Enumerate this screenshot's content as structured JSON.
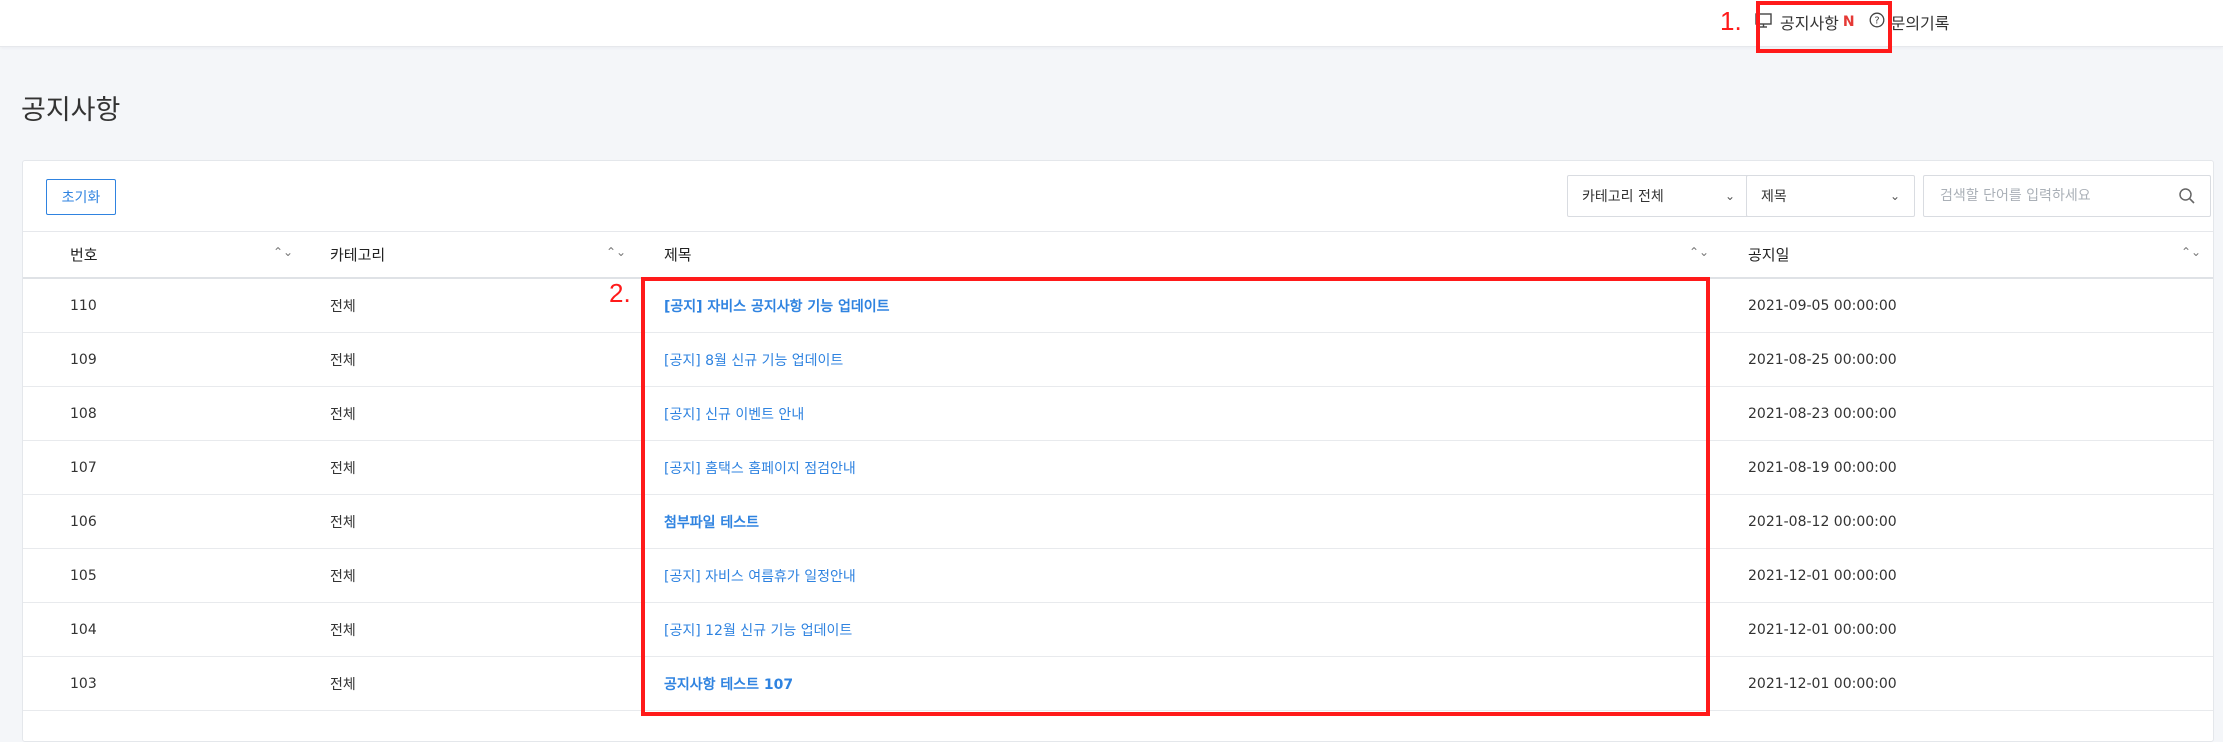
{
  "header": {
    "nav": [
      {
        "label": "공지사항",
        "badge": "N",
        "icon": "monitor-icon"
      },
      {
        "label": "문의기록",
        "icon": "question-circle-icon"
      }
    ]
  },
  "annotations": [
    "1.",
    "2."
  ],
  "page": {
    "title": "공지사항"
  },
  "toolbar": {
    "reset_label": "초기화",
    "category_select": "카테고리 전체",
    "field_select": "제목",
    "search_placeholder": "검색할 단어를 입력하세요"
  },
  "table": {
    "columns": [
      "번호",
      "카테고리",
      "제목",
      "공지일"
    ],
    "rows": [
      {
        "no": "110",
        "category": "전체",
        "title": "[공지] 자비스 공지사항 기능 업데이트",
        "date": "2021-09-05 00:00:00",
        "bold": true
      },
      {
        "no": "109",
        "category": "전체",
        "title": "[공지] 8월 신규 기능 업데이트",
        "date": "2021-08-25 00:00:00",
        "bold": false
      },
      {
        "no": "108",
        "category": "전체",
        "title": "[공지] 신규 이벤트 안내",
        "date": "2021-08-23 00:00:00",
        "bold": false
      },
      {
        "no": "107",
        "category": "전체",
        "title": "[공지] 홈택스 홈페이지 점검안내",
        "date": "2021-08-19 00:00:00",
        "bold": false
      },
      {
        "no": "106",
        "category": "전체",
        "title": "첨부파일 테스트",
        "date": "2021-08-12 00:00:00",
        "bold": true
      },
      {
        "no": "105",
        "category": "전체",
        "title": "[공지] 자비스 여름휴가 일정안내",
        "date": "2021-12-01 00:00:00",
        "bold": false
      },
      {
        "no": "104",
        "category": "전체",
        "title": "[공지] 12월 신규 기능 업데이트",
        "date": "2021-12-01 00:00:00",
        "bold": false
      },
      {
        "no": "103",
        "category": "전체",
        "title": "공지사항 테스트 107",
        "date": "2021-12-01 00:00:00",
        "bold": true
      }
    ]
  },
  "colors": {
    "accent": "#2f83e0",
    "annotation": "#ff1a1a",
    "badge": "#e53935"
  }
}
